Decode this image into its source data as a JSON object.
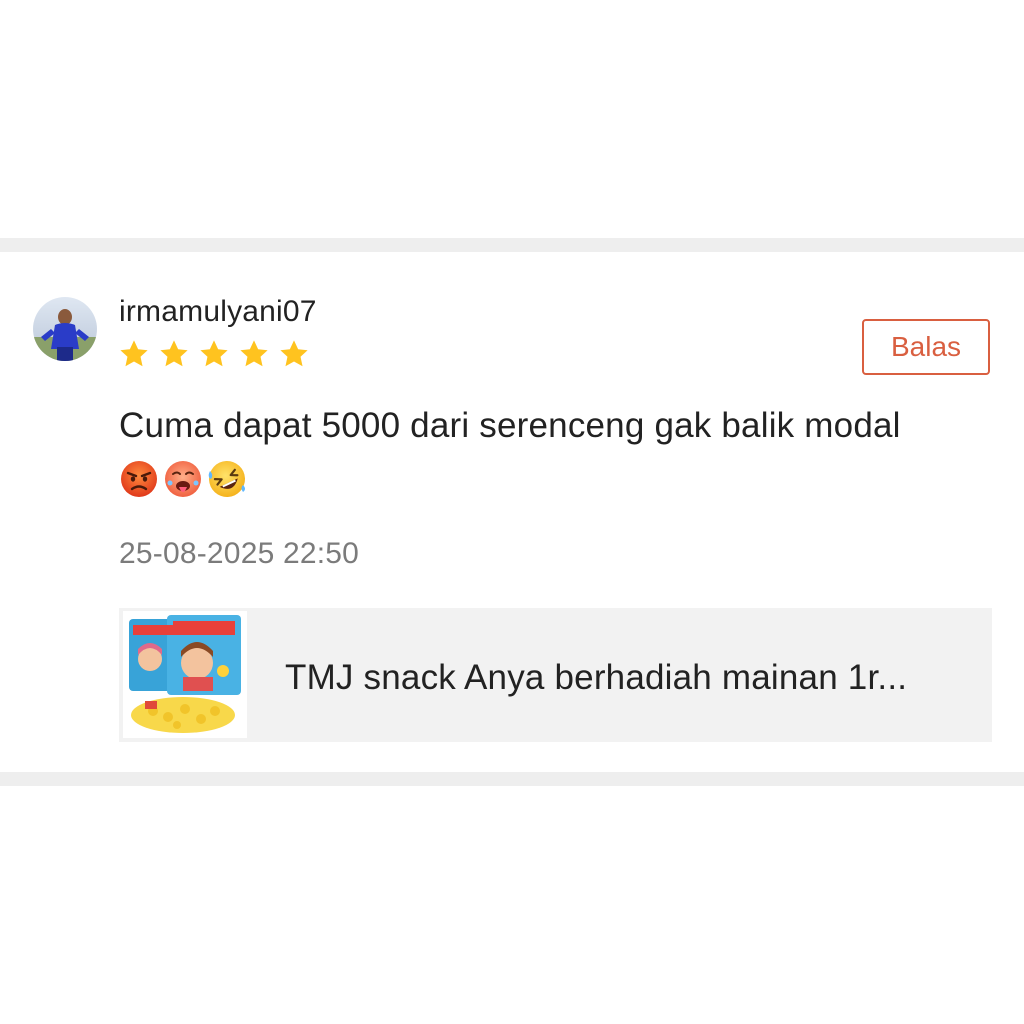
{
  "colors": {
    "divider": "#eeeeee",
    "accent": "#d95f40",
    "star": "#ffc31f",
    "text_primary": "#222222",
    "text_secondary": "#7b7b7b",
    "product_card_bg": "#f2f2f2"
  },
  "review": {
    "username": "irmamulyani07",
    "avatar_icon": "user-photo-avatar",
    "rating": 5,
    "rating_max": 5,
    "reply_label": "Balas",
    "comment": "Cuma dapat 5000 dari serenceng gak balik modal",
    "emojis": [
      "angry-face-emoji",
      "hot-face-emoji",
      "rolling-laughing-emoji"
    ],
    "timestamp": "25-08-2025 22:50"
  },
  "product": {
    "title": "TMJ snack Anya berhadiah mainan 1r...",
    "thumbnail_icon": "snack-package-thumbnail"
  }
}
